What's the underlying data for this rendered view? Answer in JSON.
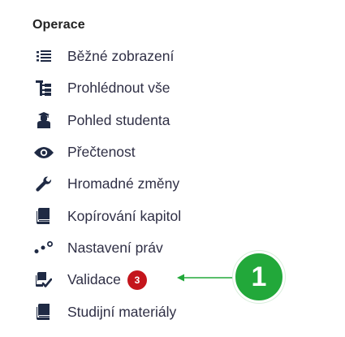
{
  "section": {
    "title": "Operace"
  },
  "menu": {
    "items": [
      {
        "label": "Běžné zobrazení",
        "icon": "list-icon"
      },
      {
        "label": "Prohlédnout vše",
        "icon": "tree-icon"
      },
      {
        "label": "Pohled studenta",
        "icon": "student-icon"
      },
      {
        "label": "Přečtenost",
        "icon": "eye-icon"
      },
      {
        "label": "Hromadné změny",
        "icon": "wrench-icon"
      },
      {
        "label": "Kopírování kapitol",
        "icon": "copy-book-icon"
      },
      {
        "label": "Nastavení práv",
        "icon": "rights-dots-icon"
      },
      {
        "label": "Validace",
        "icon": "validation-icon",
        "badge": "3"
      },
      {
        "label": "Studijní materiály",
        "icon": "book-icon"
      }
    ]
  },
  "callout": {
    "number": "1",
    "color": "#22a83a"
  },
  "colors": {
    "badge": "#c4151c",
    "icon": "#1f2a44",
    "text": "#2f2f45"
  }
}
